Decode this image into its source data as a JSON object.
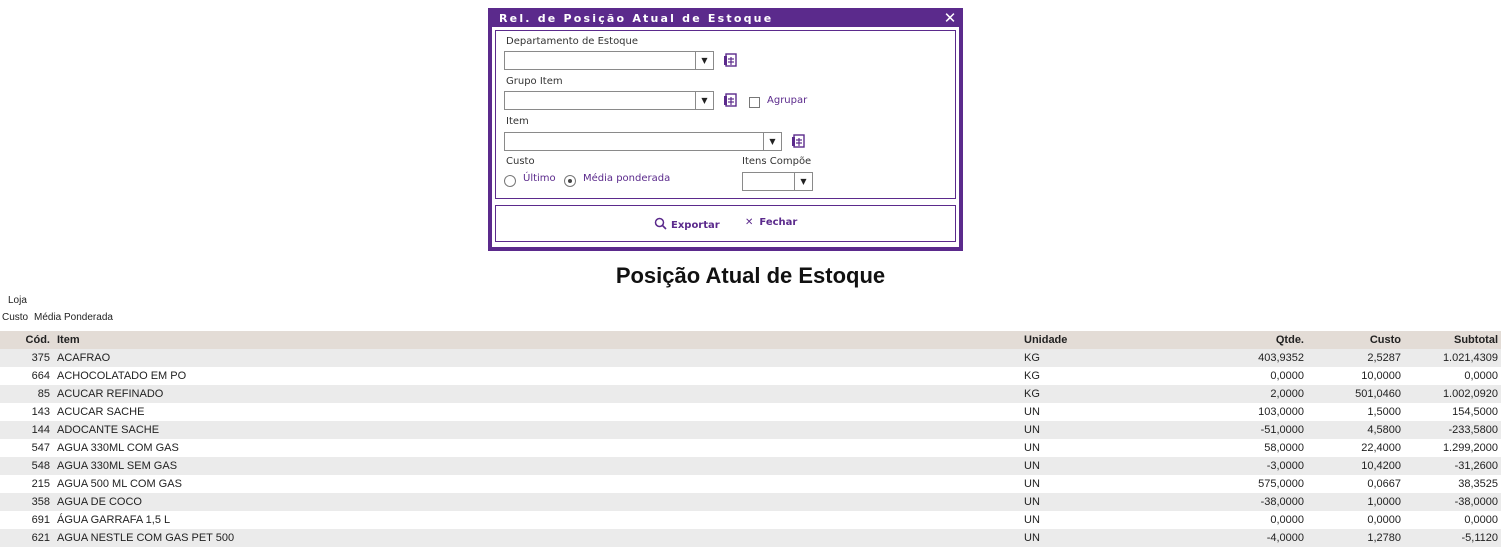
{
  "dialog": {
    "title": "Rel. de Posição Atual de Estoque",
    "fields": {
      "departamento_label": "Departamento de Estoque",
      "grupo_label": "Grupo Item",
      "agrupar_label": "Agrupar",
      "item_label": "Item",
      "custo_label": "Custo",
      "ultimo_label": "Último",
      "media_label": "Média ponderada",
      "itens_compoe_label": "Itens Compõe"
    },
    "custo_selected": "Média ponderada",
    "agrupar_checked": false,
    "exportar_label": "Exportar",
    "fechar_label": "Fechar"
  },
  "report": {
    "title": "Posição Atual de Estoque",
    "loja_label": "Loja",
    "custo_label": "Custo",
    "custo_value": "Média Ponderada",
    "columns": {
      "cod": "Cód.",
      "item": "Item",
      "unidade": "Unidade",
      "qtde": "Qtde.",
      "custo": "Custo",
      "subtotal": "Subtotal"
    },
    "rows": [
      {
        "cod": "375",
        "item": "ACAFRAO",
        "unidade": "KG",
        "qtde": "403,9352",
        "custo": "2,5287",
        "subtotal": "1.021,4309"
      },
      {
        "cod": "664",
        "item": "ACHOCOLATADO EM PO",
        "unidade": "KG",
        "qtde": "0,0000",
        "custo": "10,0000",
        "subtotal": "0,0000"
      },
      {
        "cod": "85",
        "item": "ACUCAR REFINADO",
        "unidade": "KG",
        "qtde": "2,0000",
        "custo": "501,0460",
        "subtotal": "1.002,0920"
      },
      {
        "cod": "143",
        "item": "ACUCAR SACHE",
        "unidade": "UN",
        "qtde": "103,0000",
        "custo": "1,5000",
        "subtotal": "154,5000"
      },
      {
        "cod": "144",
        "item": "ADOCANTE SACHE",
        "unidade": "UN",
        "qtde": "-51,0000",
        "custo": "4,5800",
        "subtotal": "-233,5800"
      },
      {
        "cod": "547",
        "item": "AGUA 330ML COM GAS",
        "unidade": "UN",
        "qtde": "58,0000",
        "custo": "22,4000",
        "subtotal": "1.299,2000"
      },
      {
        "cod": "548",
        "item": "AGUA 330ML SEM GAS",
        "unidade": "UN",
        "qtde": "-3,0000",
        "custo": "10,4200",
        "subtotal": "-31,2600"
      },
      {
        "cod": "215",
        "item": "AGUA 500 ML COM GAS",
        "unidade": "UN",
        "qtde": "575,0000",
        "custo": "0,0667",
        "subtotal": "38,3525"
      },
      {
        "cod": "358",
        "item": "AGUA DE COCO",
        "unidade": "UN",
        "qtde": "-38,0000",
        "custo": "1,0000",
        "subtotal": "-38,0000"
      },
      {
        "cod": "691",
        "item": "ÁGUA GARRAFA 1,5 L",
        "unidade": "UN",
        "qtde": "0,0000",
        "custo": "0,0000",
        "subtotal": "0,0000"
      },
      {
        "cod": "621",
        "item": "AGUA NESTLE COM GAS PET 500",
        "unidade": "UN",
        "qtde": "-4,0000",
        "custo": "1,2780",
        "subtotal": "-5,1120"
      }
    ]
  },
  "colors": {
    "accent": "#5b2a8c",
    "header_bg": "#e3dcd6",
    "stripe": "#ebebeb"
  }
}
